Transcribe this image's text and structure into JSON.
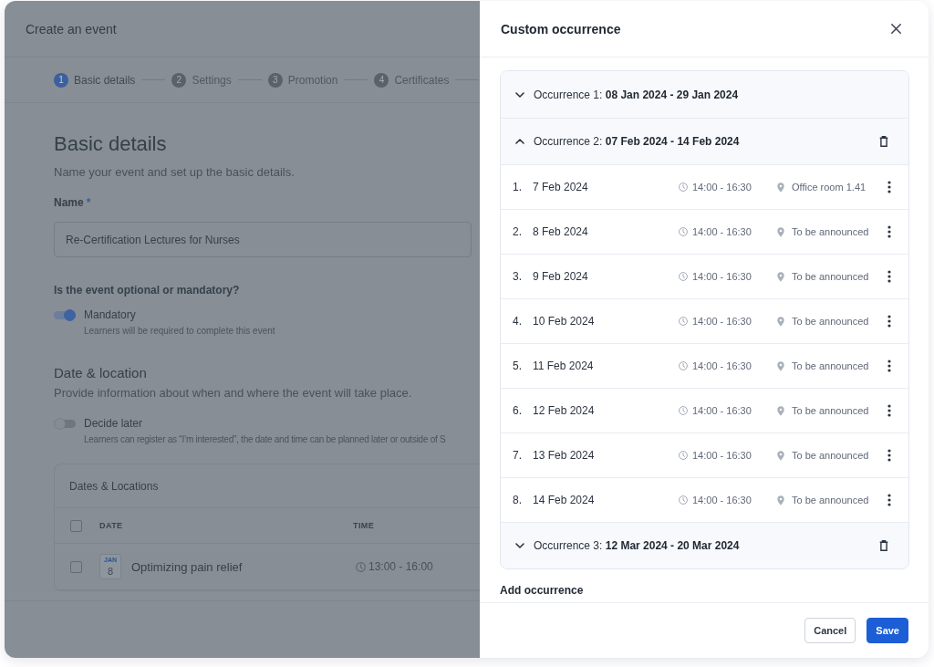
{
  "modal": {
    "title": "Create an event",
    "steps": [
      {
        "number": "1",
        "label": "Basic details",
        "selected": true
      },
      {
        "number": "2",
        "label": "Settings",
        "selected": false
      },
      {
        "number": "3",
        "label": "Promotion",
        "selected": false
      },
      {
        "number": "4",
        "label": "Certificates",
        "selected": false
      }
    ],
    "heading": "Basic details",
    "subheading": "Name your event and set up the basic details.",
    "name_field": {
      "label": "Name",
      "required_mark": "*",
      "value": "Re-Certification Lectures for Nurses"
    },
    "mandatory": {
      "question": "Is the event optional or mandatory?",
      "toggle": {
        "label": "Mandatory",
        "description": "Learners will be required to complete this event",
        "on": true
      }
    },
    "date_location": {
      "heading": "Date & location",
      "subheading": "Provide information about when and where the event will take place.",
      "toggle": {
        "label": "Decide later",
        "description": "Learners can register as “I’m interested”, the date and time can be planned later or outside of S",
        "on": false
      }
    },
    "dates_card": {
      "title": "Dates & Locations",
      "select_all_checked": false,
      "columns": [
        "DATE",
        "TIME"
      ],
      "rows": [
        {
          "checked": false,
          "month": "JAN",
          "day": "8",
          "title": "Optimizing pain relief",
          "time": "13:00 - 16:00"
        }
      ]
    }
  },
  "drawer": {
    "title": "Custom occurrence",
    "occurrences": [
      {
        "label": "Occurrence 1: **08 Jan 2024 - 29 Jan 2024**",
        "expanded": false,
        "deletable": false
      },
      {
        "label": "Occurrence 2: **07 Feb 2024 - 14 Feb 2024**",
        "expanded": true,
        "deletable": true,
        "sessions": [
          {
            "number": "1.",
            "date": "7 Feb 2024",
            "time": "14:00 - 16:30",
            "location": "Office room 1.41"
          },
          {
            "number": "2.",
            "date": "8 Feb 2024",
            "time": "14:00 - 16:30",
            "location": "To be announced"
          },
          {
            "number": "3.",
            "date": "9 Feb 2024",
            "time": "14:00 - 16:30",
            "location": "To be announced"
          },
          {
            "number": "4.",
            "date": "10 Feb 2024",
            "time": "14:00 - 16:30",
            "location": "To be announced"
          },
          {
            "number": "5.",
            "date": "11 Feb 2024",
            "time": "14:00 - 16:30",
            "location": "To be announced"
          },
          {
            "number": "6.",
            "date": "12 Feb 2024",
            "time": "14:00 - 16:30",
            "location": "To be announced"
          },
          {
            "number": "7.",
            "date": "13 Feb 2024",
            "time": "14:00 - 16:30",
            "location": "To be announced"
          },
          {
            "number": "8.",
            "date": "14 Feb 2024",
            "time": "14:00 - 16:30",
            "location": "To be announced"
          }
        ]
      },
      {
        "label": "Occurrence 3: **12 Mar 2024 - 20 Mar 2024**",
        "expanded": false,
        "deletable": true
      }
    ],
    "add_label": "Add occurrence",
    "buttons": [
      {
        "label": "Cancel",
        "kind": "secondary"
      },
      {
        "label": "Save",
        "kind": "primary"
      }
    ]
  }
}
